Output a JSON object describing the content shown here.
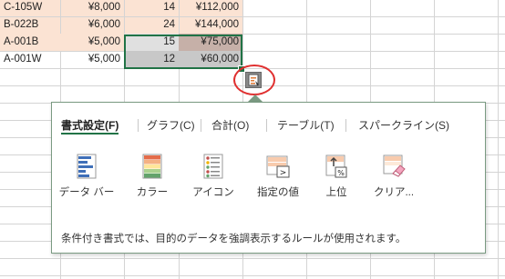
{
  "rows": [
    {
      "code": "C-105W",
      "price": "¥8,000",
      "qty": "14",
      "total": "¥112,000"
    },
    {
      "code": "B-022B",
      "price": "¥6,000",
      "qty": "24",
      "total": "¥144,000"
    },
    {
      "code": "A-001B",
      "price": "¥5,000",
      "qty": "15",
      "total": "¥75,000"
    },
    {
      "code": "A-001W",
      "price": "¥5,000",
      "qty": "12",
      "total": "¥60,000"
    }
  ],
  "colors": {
    "row_highlight": "#fbe3d3",
    "selection": "#217346",
    "qty_selected": "#d9d9d9",
    "total_dark": "#c6b0a8",
    "total_light": "#c8c8c8",
    "annotation": "#e03030"
  },
  "quick_analysis": {
    "tabs": [
      "書式設定(F)",
      "グラフ(C)",
      "合計(O)",
      "テーブル(T)",
      "スパークライン(S)"
    ],
    "active_tab": "書式設定(F)",
    "options": [
      {
        "label": "データ バー",
        "icon": "data-bar-icon"
      },
      {
        "label": "カラー",
        "icon": "color-scale-icon"
      },
      {
        "label": "アイコン",
        "icon": "icon-set-icon"
      },
      {
        "label": "指定の値",
        "icon": "greater-than-icon"
      },
      {
        "label": "上位",
        "icon": "top-percent-icon"
      },
      {
        "label": "クリア...",
        "icon": "clear-format-icon"
      }
    ],
    "description": "条件付き書式では、目的のデータを強調表示するルールが使用されます。"
  }
}
